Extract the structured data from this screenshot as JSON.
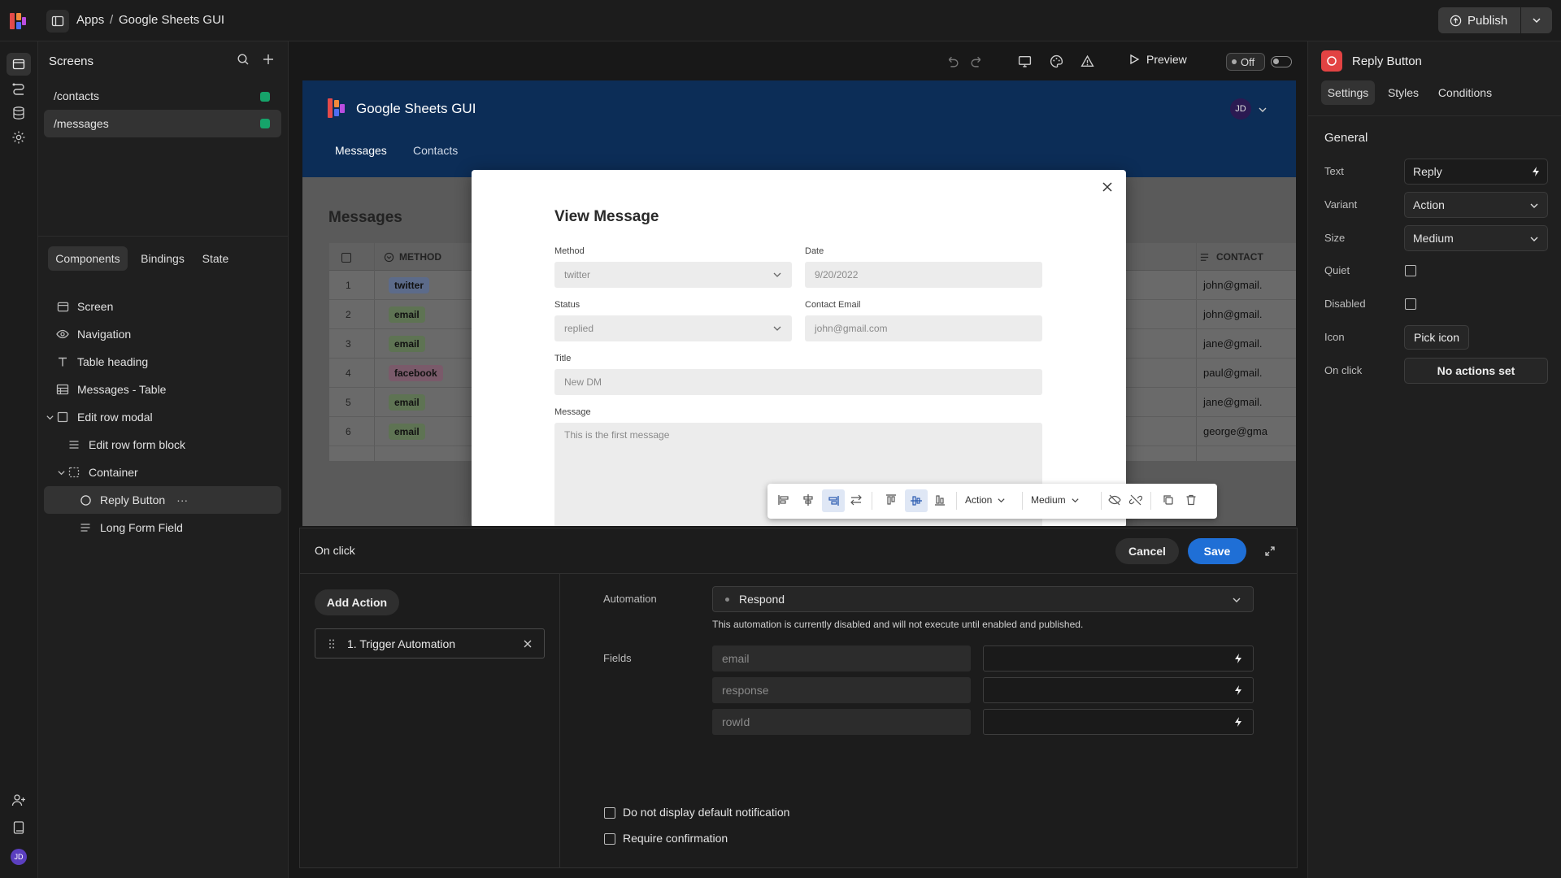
{
  "topbar": {
    "crumb_apps": "Apps",
    "crumb_sep": "/",
    "crumb_app": "Google Sheets GUI",
    "publish": "Publish"
  },
  "screens": {
    "title": "Screens",
    "items": [
      {
        "label": "/contacts"
      },
      {
        "label": "/messages"
      }
    ]
  },
  "left_tabs": {
    "components": "Components",
    "bindings": "Bindings",
    "state": "State"
  },
  "tree": {
    "screen": "Screen",
    "navigation": "Navigation",
    "table_heading": "Table heading",
    "messages_table": "Messages - Table",
    "edit_row_modal": "Edit row modal",
    "edit_row_form_block": "Edit row form block",
    "container": "Container",
    "reply_button": "Reply Button",
    "reply_more": "···",
    "long_form_field": "Long Form Field"
  },
  "preview_toolbar": {
    "preview": "Preview",
    "toggle": "Off"
  },
  "app": {
    "title": "Google Sheets GUI",
    "avatar": "JD",
    "nav": [
      "Messages",
      "Contacts"
    ],
    "page_heading": "Messages",
    "table": {
      "col_method": "METHOD",
      "col_contact": "CONTACT",
      "rows": [
        {
          "n": "1",
          "method": "twitter",
          "contact": "john@gmail."
        },
        {
          "n": "2",
          "method": "email",
          "contact": "john@gmail."
        },
        {
          "n": "3",
          "method": "email",
          "contact": "jane@gmail."
        },
        {
          "n": "4",
          "method": "facebook",
          "contact": "paul@gmail."
        },
        {
          "n": "5",
          "method": "email",
          "contact": "jane@gmail."
        },
        {
          "n": "6",
          "method": "email",
          "contact": "george@gma"
        }
      ]
    }
  },
  "modal": {
    "title": "View Message",
    "method_label": "Method",
    "method_value": "twitter",
    "date_label": "Date",
    "date_value": "9/20/2022",
    "status_label": "Status",
    "status_value": "replied",
    "email_label": "Contact Email",
    "email_placeholder": "john@gmail.com",
    "title_label": "Title",
    "title_value": "New DM",
    "message_label": "Message",
    "message_value": "This is the first message"
  },
  "floating_toolbar": {
    "variant": "Action",
    "size": "Medium"
  },
  "onclick": {
    "title": "On click",
    "cancel": "Cancel",
    "save": "Save",
    "add_action": "Add Action",
    "action_item": "1. Trigger Automation",
    "automation_label": "Automation",
    "automation_value": "Respond",
    "automation_note": "This automation is currently disabled and will not execute until enabled and published.",
    "fields_label": "Fields",
    "fields": [
      {
        "name": "email"
      },
      {
        "name": "response"
      },
      {
        "name": "rowId"
      }
    ],
    "no_notification": "Do not display default notification",
    "require_confirm": "Require confirmation"
  },
  "props": {
    "component": "Reply Button",
    "tabs": [
      "Settings",
      "Styles",
      "Conditions"
    ],
    "section": "General",
    "text_label": "Text",
    "text_value": "Reply",
    "variant_label": "Variant",
    "variant_value": "Action",
    "size_label": "Size",
    "size_value": "Medium",
    "quiet_label": "Quiet",
    "disabled_label": "Disabled",
    "icon_label": "Icon",
    "icon_button": "Pick icon",
    "onclick_label": "On click",
    "onclick_button": "No actions set"
  },
  "user": {
    "initials": "JD"
  },
  "colors": {
    "accent": "#1f6fd6",
    "app_nav": "#0c2d57",
    "status_green": "#16a36a",
    "brand_red": "#e24343"
  }
}
